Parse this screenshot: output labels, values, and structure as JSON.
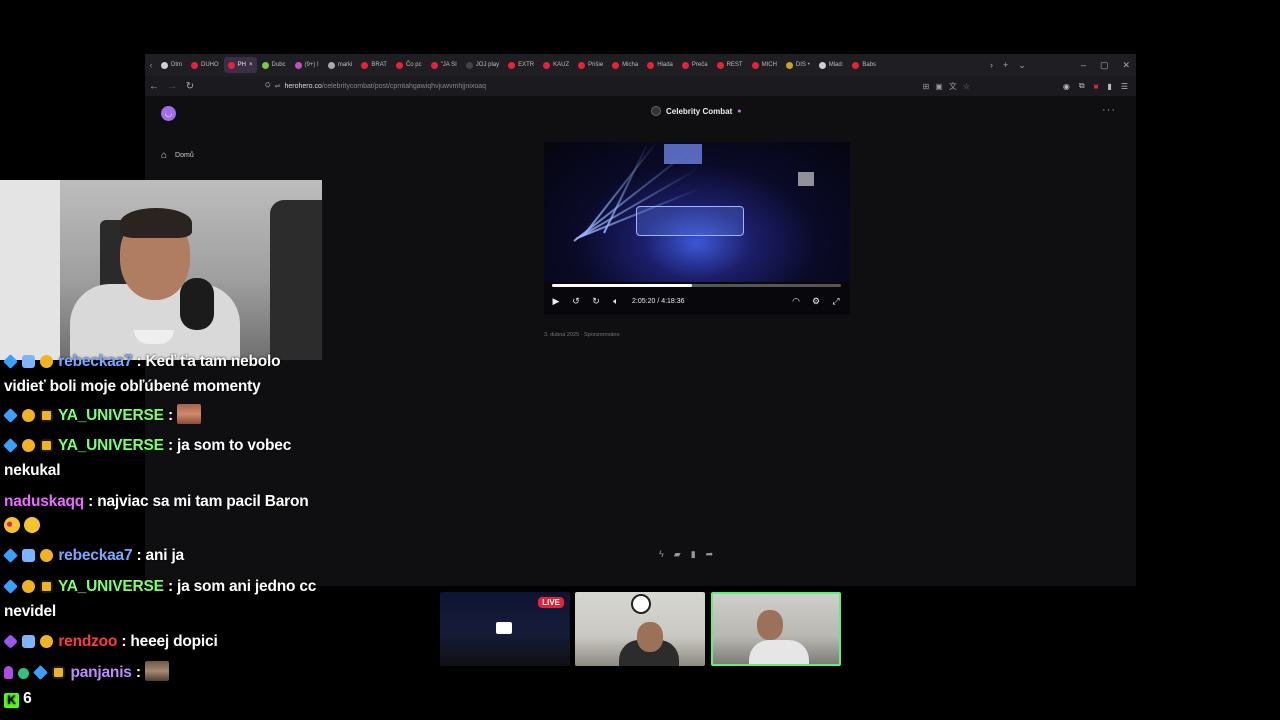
{
  "browser": {
    "tabs": [
      {
        "label": "Dtm",
        "color": "#cfcfcf"
      },
      {
        "label": "DUHO",
        "color": "#e8203a"
      },
      {
        "label": "PH",
        "color": "#e8203a",
        "active": true
      },
      {
        "label": "Dubc",
        "color": "#7ec84a"
      },
      {
        "label": "(9+) I",
        "color": "#c24fc2"
      },
      {
        "label": "marki",
        "color": "#aaaaaa"
      },
      {
        "label": "BRAT",
        "color": "#e8203a"
      },
      {
        "label": "Čo pc",
        "color": "#e8203a"
      },
      {
        "label": "\"JA SI",
        "color": "#e8203a"
      },
      {
        "label": "JOJ play",
        "color": "#444444"
      },
      {
        "label": "EXTR",
        "color": "#e8203a"
      },
      {
        "label": "KAUZ",
        "color": "#e8203a"
      },
      {
        "label": "Prišie",
        "color": "#e8203a"
      },
      {
        "label": "Micha",
        "color": "#e8203a"
      },
      {
        "label": "Hlada",
        "color": "#e8203a"
      },
      {
        "label": "Preča",
        "color": "#e8203a"
      },
      {
        "label": "REST",
        "color": "#e8203a"
      },
      {
        "label": "MICH",
        "color": "#e8203a"
      },
      {
        "label": "DIS •",
        "color": "#c9a227"
      },
      {
        "label": "Mlad:",
        "color": "#cfcfcf"
      },
      {
        "label": "Babs",
        "color": "#e8203a"
      }
    ],
    "url": {
      "host": "herohero.co",
      "path": "/celebritycombat/post/cpmtahgawiqhvjuwvmhjjnixoaq"
    }
  },
  "page": {
    "nav_home_label": "Domů",
    "creator_name": "Celebrity Combat",
    "video": {
      "current_time": "2:05:20",
      "duration": "4:18:36",
      "progress": 0.485
    },
    "post_date": "3. dubna 2025 · Sponzorováno"
  },
  "chat": {
    "messages": [
      {
        "user": "rebeckaa7",
        "color": "#7ba7ff",
        "badges": [
          "cube",
          "pen",
          "coin"
        ],
        "text": ": Keď ťa tam nebolo vidieť boli moje obľúbené momenty"
      },
      {
        "user": "YA_UNIVERSE",
        "color": "#7dff6b",
        "badges": [
          "cube",
          "coin",
          "crown"
        ],
        "text": ":"
      },
      {
        "user": "YA_UNIVERSE",
        "color": "#7dff6b",
        "badges": [
          "cube",
          "coin",
          "crown"
        ],
        "text": ": ja som to vobec nekukal"
      },
      {
        "user": "naduskaqq",
        "color": "#e96bff",
        "badges": [],
        "text": ": najviac sa mi tam pacil Baron"
      },
      {
        "user": "rebeckaa7",
        "color": "#7ba7ff",
        "badges": [
          "cube",
          "pen",
          "coin"
        ],
        "text": ": ani ja"
      },
      {
        "user": "YA_UNIVERSE",
        "color": "#7dff6b",
        "badges": [
          "cube",
          "coin",
          "crown"
        ],
        "text": ": ja som ani jedno cc nevidel"
      },
      {
        "user": "rendzoo",
        "color": "#ff3b3b",
        "badges": [
          "purple",
          "pen",
          "coin"
        ],
        "text": ": heeej dopici"
      },
      {
        "user": "panjanis",
        "color": "#b98cff",
        "badges": [
          "mic",
          "check",
          "cube",
          "crown"
        ],
        "text": ":"
      }
    ],
    "viewer_count": "6"
  },
  "thumbnails": {
    "live_label": "LIVE"
  }
}
